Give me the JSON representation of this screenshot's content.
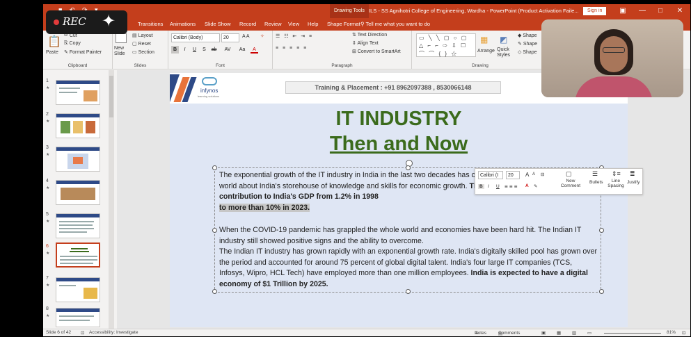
{
  "app": {
    "contextual_tab": "Drawing Tools",
    "document_title": "ILS - SS Agnihotri College of Engineering, Wardha - PowerPoint (Product Activation Faile...",
    "sign_in": "Sign in",
    "controls": {
      "ribbon_display": "▣",
      "minimize": "—",
      "maximize": "□",
      "close": "✕"
    }
  },
  "recording": {
    "label": "REC",
    "spark": "✦"
  },
  "tabs": [
    {
      "label": "Transitions"
    },
    {
      "label": "Animations"
    },
    {
      "label": "Slide Show"
    },
    {
      "label": "Record"
    },
    {
      "label": "Review"
    },
    {
      "label": "View"
    },
    {
      "label": "Help"
    },
    {
      "label": "Shape Format"
    }
  ],
  "tell_me": "Tell me what you want to do",
  "ribbon": {
    "clipboard": {
      "label": "Clipboard",
      "paste": "Paste",
      "cut": "Cut",
      "copy": "Copy",
      "format_painter": "Format Painter"
    },
    "slides": {
      "label": "Slides",
      "new_slide": "New Slide",
      "layout": "Layout",
      "reset": "Reset",
      "section": "Section"
    },
    "font": {
      "label": "Font",
      "name": "Calibri (Body)",
      "size": "20",
      "bold": "B",
      "italic": "I",
      "underline": "U",
      "strike": "S",
      "case": "Aa",
      "color": "A"
    },
    "paragraph": {
      "label": "Paragraph",
      "text_direction": "Text Direction",
      "align_text": "Align Text",
      "smartart": "Convert to SmartArt"
    },
    "drawing": {
      "label": "Drawing",
      "arrange": "Arrange",
      "quick_styles": "Quick Styles",
      "shape_fill": "Shape",
      "shape_outline": "Shape",
      "shape_effects": "Shape"
    }
  },
  "thumbnails": [
    {
      "num": "1",
      "star": "★"
    },
    {
      "num": "2",
      "star": "★"
    },
    {
      "num": "3",
      "star": "★"
    },
    {
      "num": "4",
      "star": "★"
    },
    {
      "num": "5",
      "star": "★"
    },
    {
      "num": "6",
      "star": "★"
    },
    {
      "num": "7",
      "star": "★"
    },
    {
      "num": "8",
      "star": "★"
    }
  ],
  "slide": {
    "logo": "infynos",
    "logo_sub": "learning solutions",
    "banner": "Training & Placement : +91 8962097388 , 8530066148",
    "title_line1": "IT INDUSTRY",
    "title_line2": "Then and Now",
    "p1_plain": "The exponential growth of the IT industry in India in the last two decades has changed the perception of the whole world about India's storehouse of knowledge and skills for economic growth. ",
    "p1_bold": "The IT sector has increased its contribution to India's GDP from 1.2% in 1998",
    "p1_bold_hl": "to more than 10% in 2023.",
    "p2": "When the COVID-19 pandemic has grappled the whole world and economies have been hard hit. The Indian IT industry  still showed positive signs and  the ability to overcome.",
    "p3": "The Indian IT industry has grown rapidly with an exponential growth rate. India's digitally skilled pool has grown over the period and accounted for around 75 percent of global digital talent. India's four large IT companies (TCS, Infosys, Wipro, HCL Tech) have employed more than one million employees. ",
    "p3_bold": "India is expected to have a digital economy of $1 Trillion by 2025."
  },
  "mini_toolbar": {
    "font": "Calibri (I",
    "size": "20",
    "grow": "A",
    "shrink": "A",
    "bold": "B",
    "italic": "I",
    "underline": "U",
    "new_comment": "New Comment",
    "bullets": "Bullets",
    "line_spacing": "Line Spacing",
    "justify": "Justify"
  },
  "status": {
    "slide_info": "Slide 6 of 42",
    "accessibility": "Accessibility: Investigate",
    "notes": "Notes",
    "comments": "Comments",
    "zoom": "81%"
  },
  "colors": {
    "accent": "#c43e1c",
    "title_green": "#3b6b1c"
  }
}
